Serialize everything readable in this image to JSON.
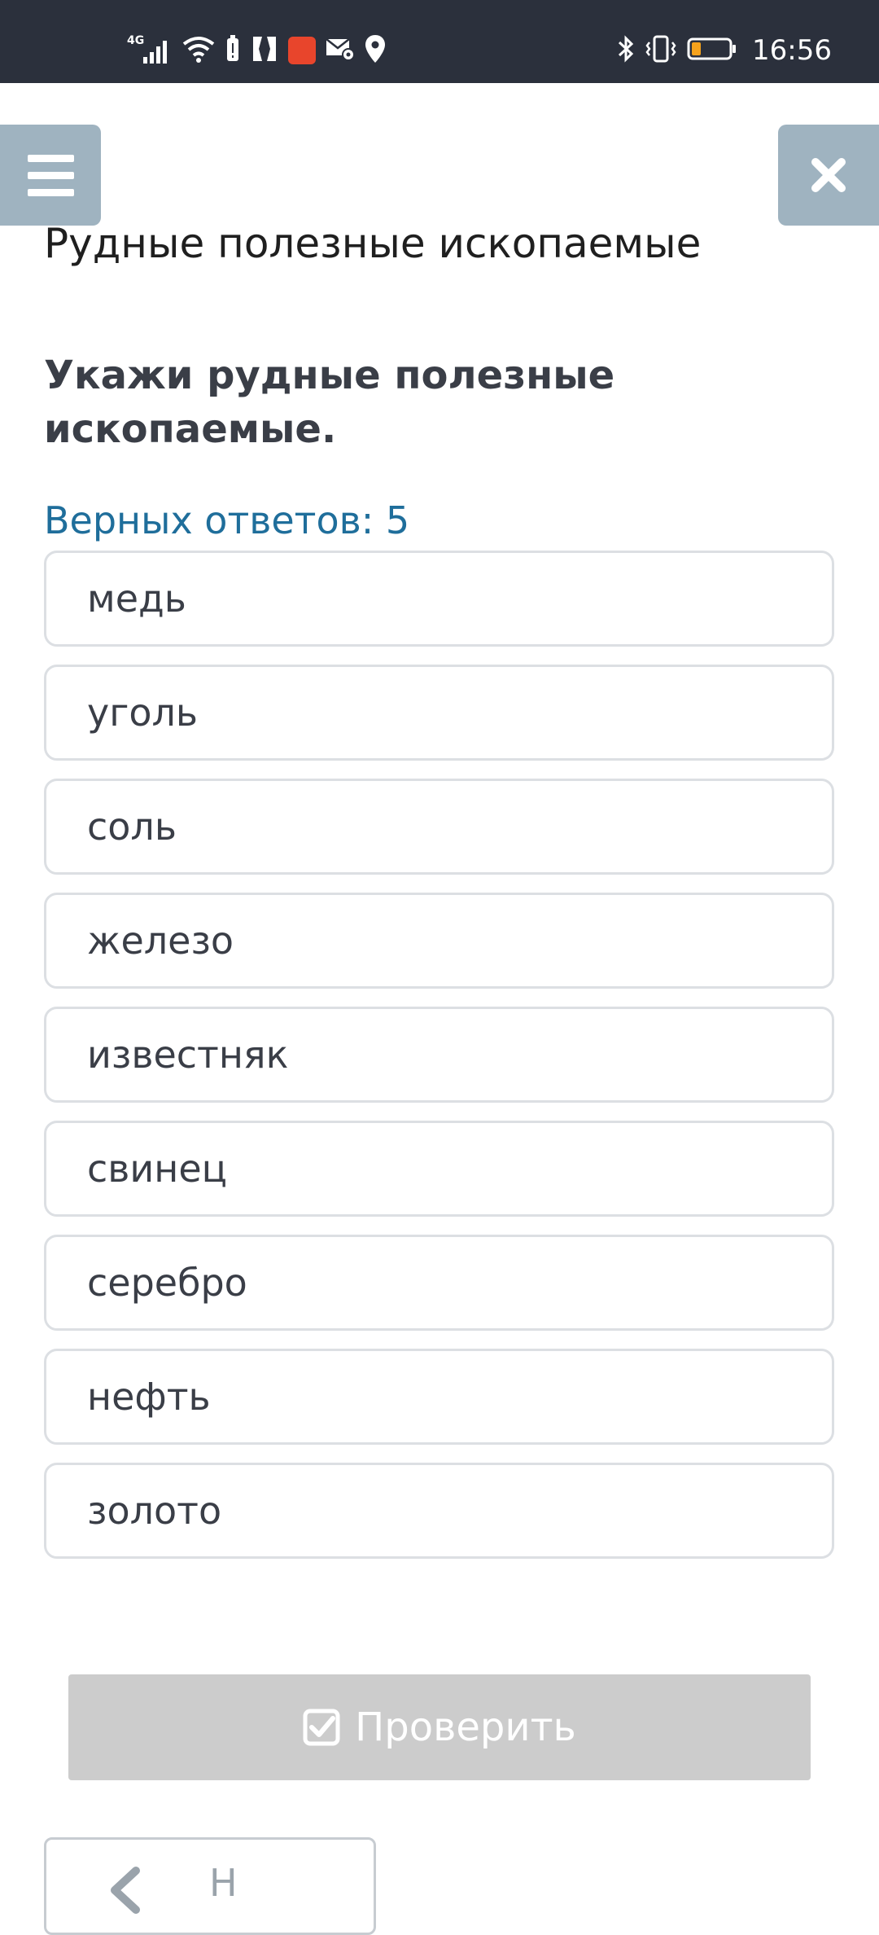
{
  "status_bar": {
    "network": "4G",
    "time": "16:56",
    "icons_left": [
      "signal-icon",
      "wifi-icon",
      "battery-saver-icon",
      "app-icon",
      "aliexpress-icon",
      "mail-settings-icon",
      "location-icon"
    ],
    "icons_right": [
      "bluetooth-icon",
      "vibrate-icon",
      "battery-icon"
    ]
  },
  "header": {
    "menu_icon": "hamburger-menu-icon",
    "close_icon": "close-icon"
  },
  "page": {
    "title": "Рудные полезные ископаемые",
    "question": "Укажи рудные полезные ископаемые.",
    "answers_count": "Верных ответов: 5"
  },
  "options": [
    {
      "label": "медь"
    },
    {
      "label": "уголь"
    },
    {
      "label": "соль"
    },
    {
      "label": "железо"
    },
    {
      "label": "известняк"
    },
    {
      "label": "свинец"
    },
    {
      "label": "серебро"
    },
    {
      "label": "нефть"
    },
    {
      "label": "золото"
    }
  ],
  "actions": {
    "check_label": "Проверить",
    "back_label": "Н"
  },
  "colors": {
    "status_bar_bg": "#2b303c",
    "nav_button_bg": "#9fb3c0",
    "answers_count_text": "#1f6e9b",
    "check_button_disabled_bg": "#cccccc",
    "option_border": "#dcdfe3"
  }
}
